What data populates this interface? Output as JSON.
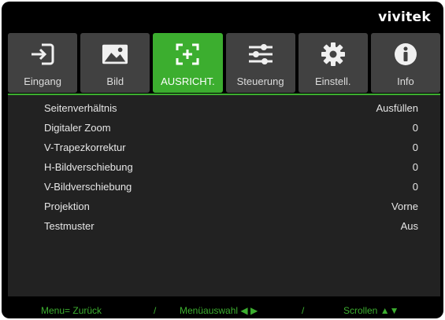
{
  "brand": "vivitek",
  "tabs": [
    {
      "label": "Eingang",
      "icon": "input-arrow-icon",
      "active": false
    },
    {
      "label": "Bild",
      "icon": "picture-icon",
      "active": false
    },
    {
      "label": "AUSRICHT.",
      "icon": "alignment-frame-icon",
      "active": true
    },
    {
      "label": "Steuerung",
      "icon": "sliders-icon",
      "active": false
    },
    {
      "label": "Einstell.",
      "icon": "gear-icon",
      "active": false
    },
    {
      "label": "Info",
      "icon": "info-icon",
      "active": false
    }
  ],
  "menu": {
    "items": [
      {
        "label": "Seitenverhältnis",
        "value": "Ausfüllen"
      },
      {
        "label": "Digitaler Zoom",
        "value": "0"
      },
      {
        "label": "V-Trapezkorrektur",
        "value": "0"
      },
      {
        "label": "H-Bildverschiebung",
        "value": "0"
      },
      {
        "label": "V-Bildverschiebung",
        "value": "0"
      },
      {
        "label": "Projektion",
        "value": "Vorne"
      },
      {
        "label": "Testmuster",
        "value": "Aus"
      }
    ]
  },
  "footer": {
    "back": "Menu= Zurück",
    "sep1": "/",
    "select": "Menüauswahl ◀ ▶",
    "sep2": "/",
    "scroll": "Scrollen ▲▼"
  },
  "colors": {
    "accent": "#3cae2f",
    "tab_bg": "#414141",
    "menu_bg": "#222222",
    "frame_bg": "#000000"
  }
}
